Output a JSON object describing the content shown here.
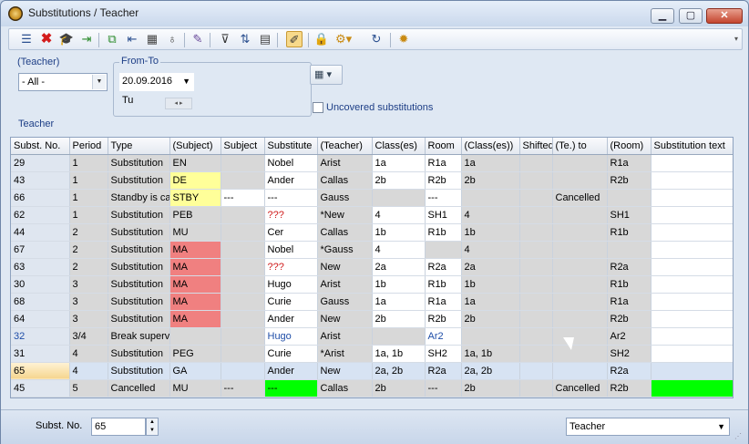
{
  "window": {
    "title": "Substitutions / Teacher"
  },
  "toolbar": {
    "icons": [
      "grid-icon",
      "delete-icon",
      "graduation-cap-icon",
      "export-icon",
      "copy-icon",
      "import-icon",
      "calculator-icon",
      "stethoscope-icon",
      "wand-icon",
      "filter-icon",
      "sort-icon",
      "columns-icon",
      "highlight-icon",
      "lock-icon",
      "settings-dropdown-icon",
      "refresh-icon",
      "gear-icon"
    ]
  },
  "filter": {
    "teacher_label": "(Teacher)",
    "teacher_value": "- All -",
    "fromto_label": "From-To",
    "date_value": "20.09.2016",
    "day_label": "Tu",
    "uncovered_label": "Uncovered substitutions",
    "teacher_section_label": "Teacher"
  },
  "columns": [
    "Subst. No.",
    "Period",
    "Type",
    "(Subject)",
    "Subject",
    "Substitute",
    "(Teacher)",
    "Class(es)",
    "Room",
    "(Class(es))",
    "Shifted",
    "(Te.) to",
    "(Room)",
    "Substitution text"
  ],
  "rows": [
    [
      "29",
      "1",
      "Substitution",
      "EN",
      "",
      "Nobel",
      "Arist",
      "1a",
      "R1a",
      "1a",
      "",
      "",
      "R1a",
      ""
    ],
    [
      "43",
      "1",
      "Substitution",
      "DE",
      "",
      "Ander",
      "Callas",
      "2b",
      "R2b",
      "2b",
      "",
      "",
      "R2b",
      ""
    ],
    [
      "66",
      "1",
      "Standby is ca",
      "STBY",
      "---",
      "---",
      "Gauss",
      "",
      "---",
      "",
      "",
      "Cancelled",
      "",
      ""
    ],
    [
      "62",
      "1",
      "Substitution",
      "PEB",
      "",
      "???",
      "*New",
      "4",
      "SH1",
      "4",
      "",
      "",
      "SH1",
      ""
    ],
    [
      "44",
      "2",
      "Substitution",
      "MU",
      "",
      "Cer",
      "Callas",
      "1b",
      "R1b",
      "1b",
      "",
      "",
      "R1b",
      ""
    ],
    [
      "67",
      "2",
      "Substitution",
      "MA",
      "",
      "Nobel",
      "*Gauss",
      "4",
      "",
      "4",
      "",
      "",
      "",
      ""
    ],
    [
      "63",
      "2",
      "Substitution",
      "MA",
      "",
      "???",
      "New",
      "2a",
      "R2a",
      "2a",
      "",
      "",
      "R2a",
      ""
    ],
    [
      "30",
      "3",
      "Substitution",
      "MA",
      "",
      "Hugo",
      "Arist",
      "1b",
      "R1b",
      "1b",
      "",
      "",
      "R1b",
      ""
    ],
    [
      "68",
      "3",
      "Substitution",
      "MA",
      "",
      "Curie",
      "Gauss",
      "1a",
      "R1a",
      "1a",
      "",
      "",
      "R1a",
      ""
    ],
    [
      "64",
      "3",
      "Substitution",
      "MA",
      "",
      "Ander",
      "New",
      "2b",
      "R2b",
      "2b",
      "",
      "",
      "R2b",
      ""
    ],
    [
      "32",
      "3/4",
      "Break superv",
      "",
      "",
      "Hugo",
      "Arist",
      "",
      "Ar2",
      "",
      "",
      "",
      "Ar2",
      ""
    ],
    [
      "31",
      "4",
      "Substitution",
      "PEG",
      "",
      "Curie",
      "*Arist",
      "1a, 1b",
      "SH2",
      "1a, 1b",
      "",
      "",
      "SH2",
      ""
    ],
    [
      "65",
      "4",
      "Substitution",
      "GA",
      "",
      "Ander",
      "New",
      "2a, 2b",
      "R2a",
      "2a, 2b",
      "",
      "",
      "R2a",
      ""
    ],
    [
      "45",
      "5",
      "Cancelled",
      "MU",
      "---",
      "---",
      "Callas",
      "2b",
      "---",
      "2b",
      "",
      "Cancelled",
      "R2b",
      ""
    ]
  ],
  "status": {
    "subst_label": "Subst. No.",
    "subst_value": "65",
    "view_value": "Teacher"
  }
}
